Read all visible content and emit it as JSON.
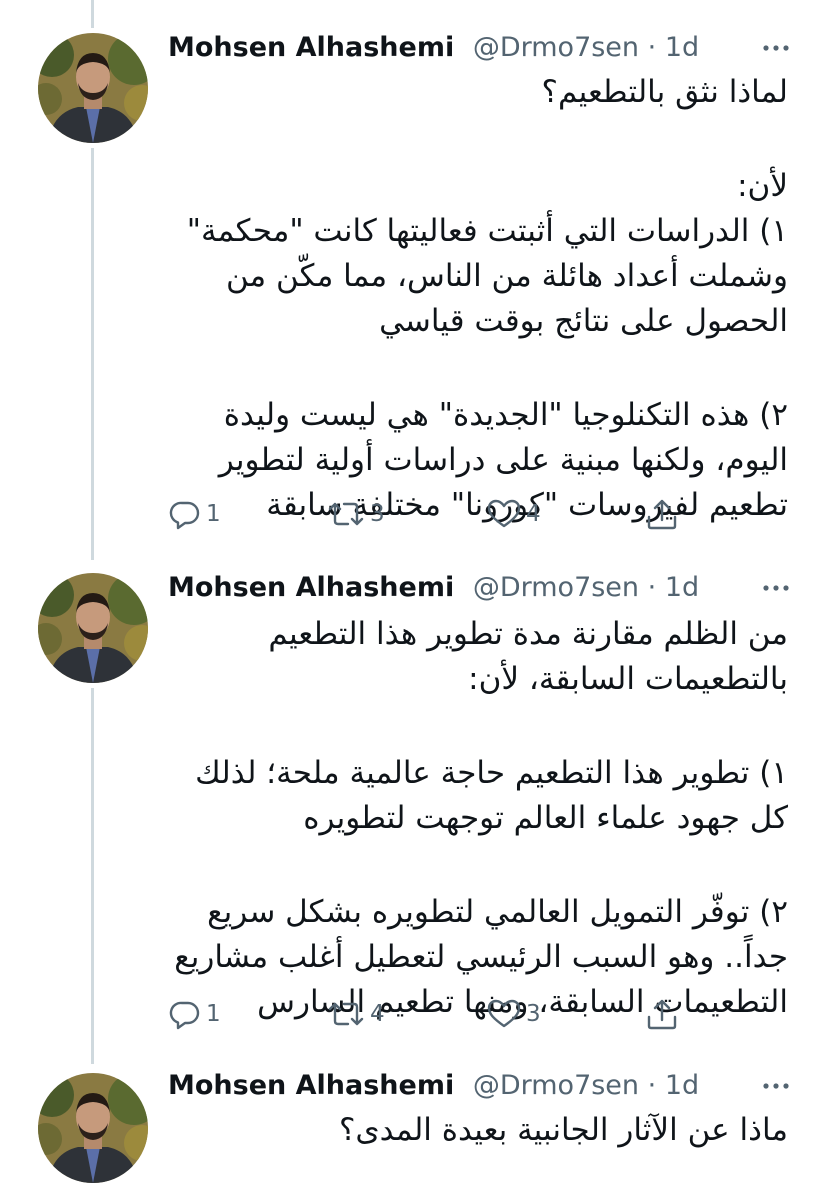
{
  "tweets": [
    {
      "author": {
        "name": "Mohsen Alhashemi",
        "handle": "@Drmo7sen",
        "separator": "·",
        "time": "1d"
      },
      "lines": [
        "لماذا نثق بالتطعيم؟",
        "",
        "لأن:",
        "١) الدراسات التي أثبتت فعاليتها كانت \"محكمة\"",
        "وشملت أعداد هائلة من الناس، مما مكّن من",
        "الحصول على نتائج بوقت قياسي",
        "",
        "٢) هذه التكنلوجيا \"الجديدة\" هي ليست وليدة",
        "اليوم، ولكنها مبنية على دراسات أولية لتطوير",
        "تطعيم لفيروسات \"كورونا\" مختلفة سابقة"
      ],
      "stats": {
        "replies": "1",
        "retweets": "3",
        "likes": "4"
      }
    },
    {
      "author": {
        "name": "Mohsen Alhashemi",
        "handle": "@Drmo7sen",
        "separator": "·",
        "time": "1d"
      },
      "lines": [
        "من الظلم مقارنة مدة تطوير هذا التطعيم",
        "بالتطعيمات السابقة، لأن:",
        "",
        "١) تطوير هذا التطعيم حاجة عالمية ملحة؛ لذلك",
        "كل جهود علماء العالم توجهت لتطويره",
        "",
        "٢) توفّر التمويل العالمي لتطويره بشكل سريع",
        "جداً.. وهو السبب الرئيسي لتعطيل أغلب مشاريع",
        "التطعيمات السابقة، ومنها تطعيم السارس"
      ],
      "stats": {
        "replies": "1",
        "retweets": "4",
        "likes": "3"
      }
    },
    {
      "author": {
        "name": "Mohsen Alhashemi",
        "handle": "@Drmo7sen",
        "separator": "·",
        "time": "1d"
      },
      "lines": [
        "ماذا عن الآثار الجانبية بعيدة المدى؟"
      ]
    }
  ],
  "icons": {
    "more": "more-horizontal-icon",
    "reply": "reply-icon",
    "retweet": "retweet-icon",
    "like": "heart-icon",
    "share": "share-icon"
  },
  "colors": {
    "text": "#0f1419",
    "secondary": "#536471",
    "thread_line": "#cfd9de",
    "background": "#ffffff"
  }
}
